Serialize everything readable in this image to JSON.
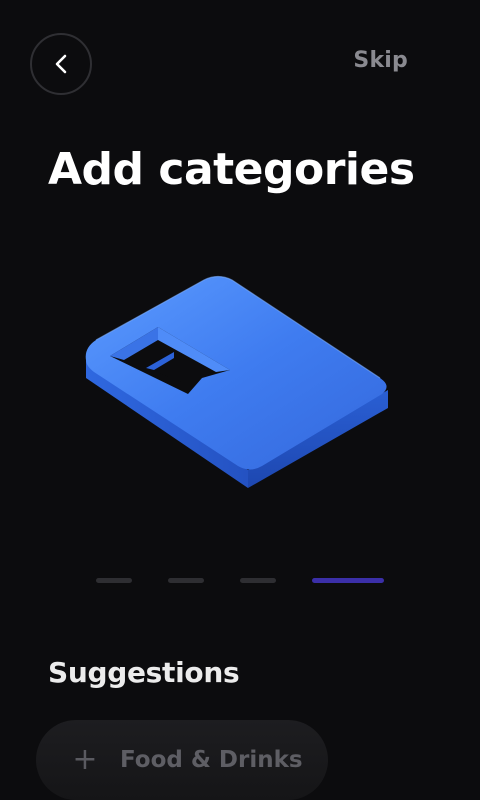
{
  "header": {
    "back_icon": "chevron-left-icon",
    "skip_label": "Skip"
  },
  "main": {
    "title": "Add categories",
    "illustration_icon": "folder-tag-3d-icon",
    "pager": {
      "total": 4,
      "active_index": 3,
      "active_color": "#3b2fa8"
    }
  },
  "suggestions": {
    "title": "Suggestions",
    "items": [
      {
        "icon": "plus-icon",
        "plus_glyph": "+",
        "label": "Food & Drinks"
      }
    ]
  },
  "colors": {
    "background": "#0c0c0e",
    "accent": "#3b2fa8",
    "illustration_blue": "#3f7cf0"
  }
}
